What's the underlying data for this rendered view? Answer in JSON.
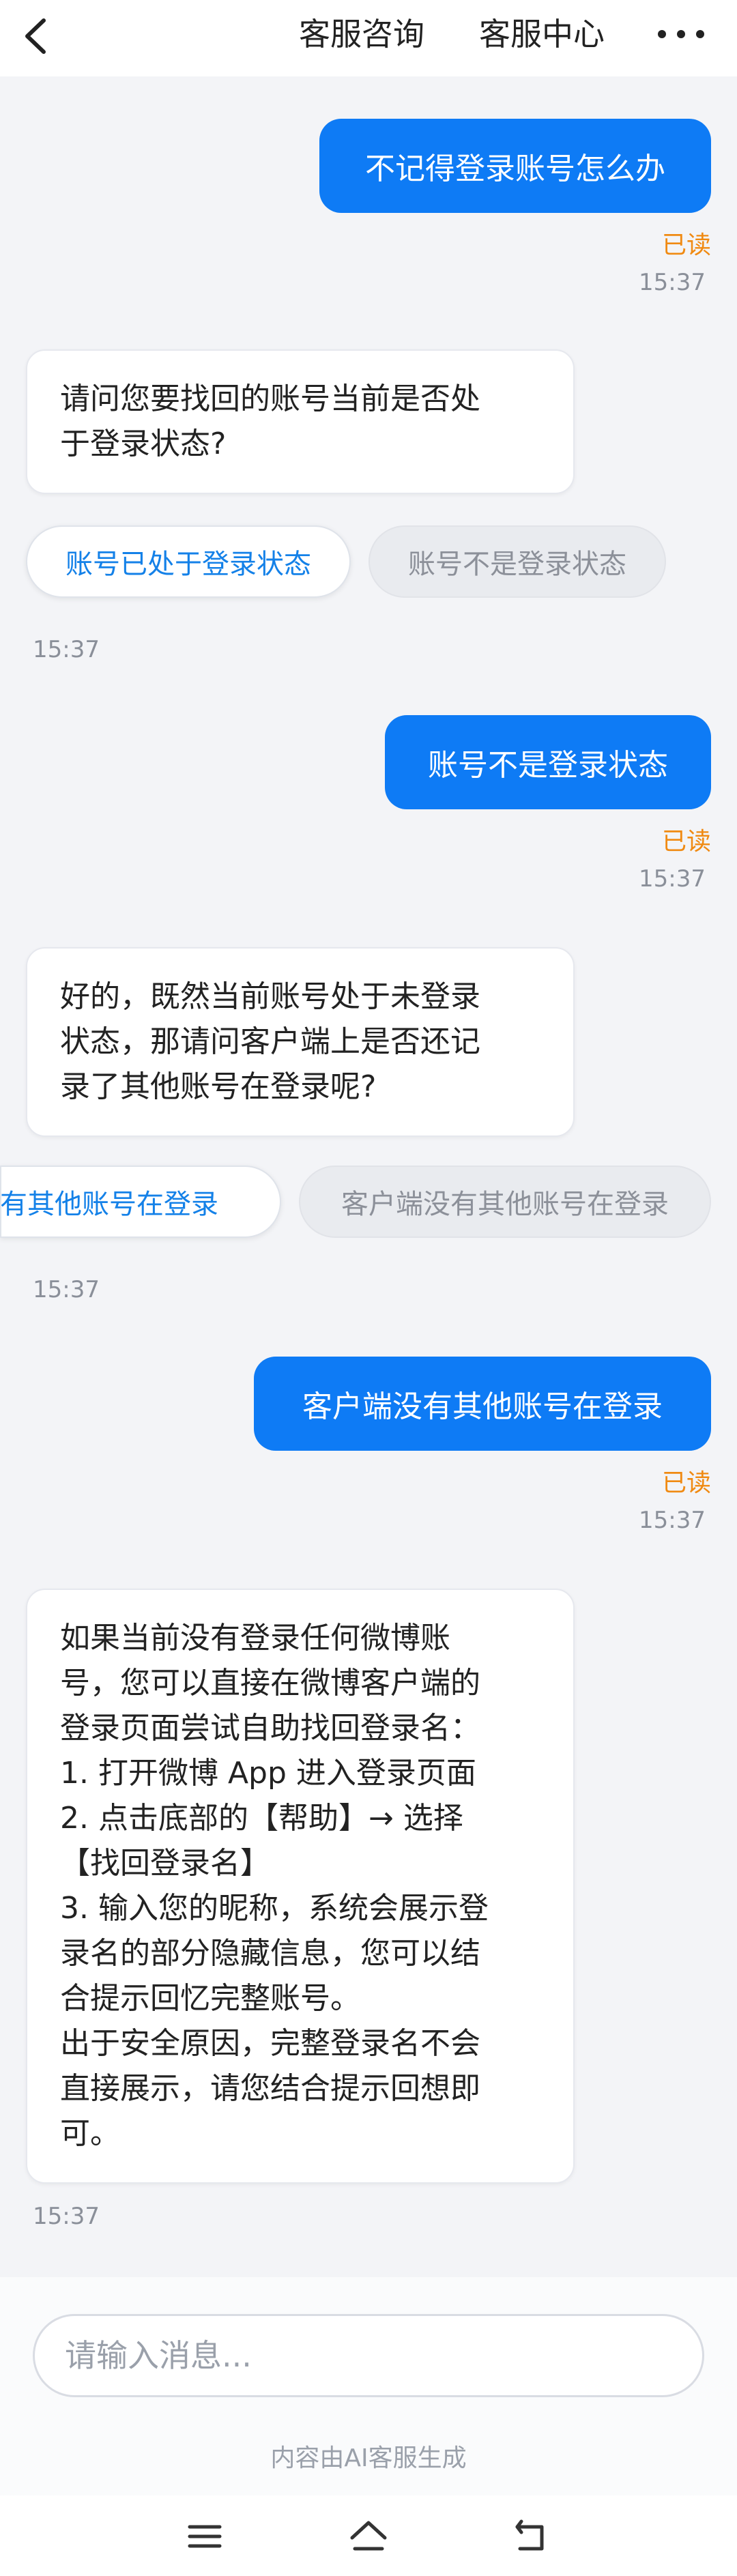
{
  "header": {
    "consult_label": "客服咨询",
    "center_label": "客服中心"
  },
  "messages": [
    {
      "type": "out",
      "text": "不记得登录账号怎么办",
      "read": "已读",
      "time": "15:37"
    },
    {
      "type": "in",
      "lines": [
        "请问您要找回的账号当前是否处",
        "于登录状态?"
      ],
      "time": "15:37",
      "options": [
        "账号已处于登录状态",
        "账号不是登录状态"
      ]
    },
    {
      "type": "out",
      "text": "账号不是登录状态",
      "read": "已读",
      "time": "15:37"
    },
    {
      "type": "in",
      "lines": [
        "好的，既然当前账号处于未登录",
        "状态，那请问客户端上是否还记",
        "录了其他账号在登录呢?"
      ],
      "time": "15:37",
      "options": [
        "有其他账号在登录",
        "客户端没有其他账号在登录"
      ]
    },
    {
      "type": "out",
      "text": "客户端没有其他账号在登录",
      "read": "已读",
      "time": "15:37"
    },
    {
      "type": "in",
      "lines": [
        "如果当前没有登录任何微博账",
        "号，您可以直接在微博客户端的",
        "登录页面尝试自助找回登录名：",
        "1. 打开微博 App 进入登录页面",
        "2. 点击底部的【帮助】→ 选择",
        "【找回登录名】",
        "3. 输入您的昵称，系统会展示登",
        "录名的部分隐藏信息，您可以结",
        "合提示回忆完整账号。",
        "出于安全原因，完整登录名不会",
        "直接展示，请您结合提示回想即",
        "可。"
      ],
      "time": "15:37"
    }
  ],
  "input": {
    "placeholder": "请输入消息..."
  },
  "footer_note": "内容由AI客服生成",
  "icons": {
    "back": "chevron-left-icon",
    "more": "more-dots-icon",
    "nav_menu": "menu-icon",
    "nav_home": "home-icon",
    "nav_back": "back-arrow-icon"
  },
  "colors": {
    "accent": "#0e7bf5",
    "read_status": "#f08a12",
    "chip_active_text": "#1481e8"
  }
}
